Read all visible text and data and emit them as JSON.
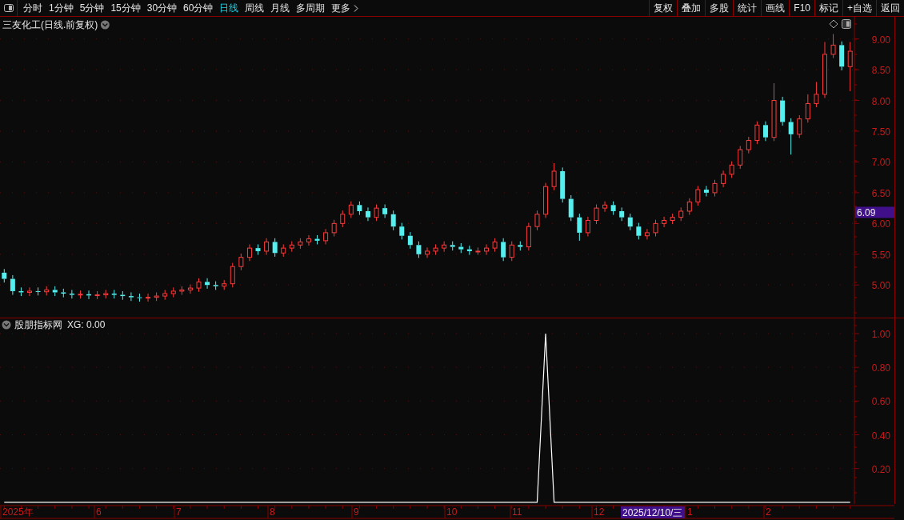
{
  "toolbar": {
    "periods": [
      {
        "label": "分时",
        "selected": false
      },
      {
        "label": "1分钟",
        "selected": false
      },
      {
        "label": "5分钟",
        "selected": false
      },
      {
        "label": "15分钟",
        "selected": false
      },
      {
        "label": "30分钟",
        "selected": false
      },
      {
        "label": "60分钟",
        "selected": false
      },
      {
        "label": "日线",
        "selected": true
      },
      {
        "label": "周线",
        "selected": false
      },
      {
        "label": "月线",
        "selected": false
      },
      {
        "label": "多周期",
        "selected": false
      },
      {
        "label": "更多",
        "selected": false
      }
    ],
    "actions": [
      "复权",
      "叠加",
      "多股",
      "统计",
      "画线",
      "F10",
      "标记",
      "+自选",
      "返回"
    ]
  },
  "main_chart": {
    "title": "三友化工(日线.前复权)",
    "price_cursor": "6.09",
    "chart_data": {
      "type": "candlestick",
      "grid": true,
      "ylim": [
        4.47,
        9.36
      ],
      "yticks": [
        {
          "value": 5,
          "label": "5.00"
        },
        {
          "value": 5.5,
          "label": "5.50"
        },
        {
          "value": 6,
          "label": "6.00"
        },
        {
          "value": 6.5,
          "label": "6.50"
        },
        {
          "value": 7,
          "label": "7.00"
        },
        {
          "value": 7.5,
          "label": "7.50"
        },
        {
          "value": 8,
          "label": "8.00"
        },
        {
          "value": 8.5,
          "label": "8.50"
        },
        {
          "value": 9,
          "label": "9.00"
        }
      ],
      "ohlc": [
        [
          5.2,
          5.26,
          5.04,
          5.1
        ],
        [
          5.1,
          5.16,
          4.84,
          4.9
        ],
        [
          4.9,
          4.96,
          4.82,
          4.88
        ],
        [
          4.88,
          4.96,
          4.82,
          4.9
        ],
        [
          4.9,
          4.96,
          4.83,
          4.89
        ],
        [
          4.89,
          4.98,
          4.83,
          4.92
        ],
        [
          4.92,
          4.98,
          4.82,
          4.88
        ],
        [
          4.88,
          4.94,
          4.8,
          4.86
        ],
        [
          4.86,
          4.92,
          4.78,
          4.84
        ],
        [
          4.84,
          4.91,
          4.78,
          4.85
        ],
        [
          4.85,
          4.91,
          4.77,
          4.83
        ],
        [
          4.83,
          4.9,
          4.77,
          4.84
        ],
        [
          4.84,
          4.92,
          4.78,
          4.86
        ],
        [
          4.86,
          4.92,
          4.78,
          4.84
        ],
        [
          4.84,
          4.9,
          4.76,
          4.82
        ],
        [
          4.82,
          4.88,
          4.74,
          4.8
        ],
        [
          4.8,
          4.86,
          4.73,
          4.79
        ],
        [
          4.79,
          4.86,
          4.73,
          4.8
        ],
        [
          4.8,
          4.88,
          4.74,
          4.82
        ],
        [
          4.82,
          4.92,
          4.76,
          4.86
        ],
        [
          4.86,
          4.96,
          4.8,
          4.9
        ],
        [
          4.9,
          4.98,
          4.84,
          4.92
        ],
        [
          4.92,
          5.01,
          4.86,
          4.95
        ],
        [
          4.95,
          5.11,
          4.89,
          5.05
        ],
        [
          5.05,
          5.11,
          4.94,
          5.0
        ],
        [
          5.0,
          5.06,
          4.92,
          4.98
        ],
        [
          4.98,
          5.08,
          4.92,
          5.02
        ],
        [
          5.02,
          5.36,
          4.96,
          5.3
        ],
        [
          5.3,
          5.51,
          5.24,
          5.45
        ],
        [
          5.45,
          5.66,
          5.39,
          5.6
        ],
        [
          5.6,
          5.66,
          5.49,
          5.55
        ],
        [
          5.55,
          5.76,
          5.49,
          5.7
        ],
        [
          5.7,
          5.76,
          5.46,
          5.52
        ],
        [
          5.52,
          5.66,
          5.46,
          5.6
        ],
        [
          5.6,
          5.71,
          5.54,
          5.65
        ],
        [
          5.65,
          5.76,
          5.59,
          5.7
        ],
        [
          5.7,
          5.81,
          5.64,
          5.75
        ],
        [
          5.75,
          5.81,
          5.66,
          5.72
        ],
        [
          5.72,
          5.91,
          5.66,
          5.85
        ],
        [
          5.85,
          6.06,
          5.79,
          6.0
        ],
        [
          6.0,
          6.21,
          5.94,
          6.15
        ],
        [
          6.15,
          6.36,
          6.09,
          6.3
        ],
        [
          6.3,
          6.36,
          6.14,
          6.2
        ],
        [
          6.2,
          6.26,
          6.04,
          6.1
        ],
        [
          6.1,
          6.31,
          6.04,
          6.25
        ],
        [
          6.25,
          6.31,
          6.09,
          6.15
        ],
        [
          6.15,
          6.21,
          5.89,
          5.95
        ],
        [
          5.95,
          6.01,
          5.74,
          5.8
        ],
        [
          5.8,
          5.86,
          5.59,
          5.65
        ],
        [
          5.65,
          5.71,
          5.44,
          5.5
        ],
        [
          5.5,
          5.61,
          5.44,
          5.55
        ],
        [
          5.55,
          5.66,
          5.49,
          5.6
        ],
        [
          5.6,
          5.71,
          5.54,
          5.65
        ],
        [
          5.65,
          5.71,
          5.56,
          5.62
        ],
        [
          5.62,
          5.68,
          5.52,
          5.58
        ],
        [
          5.58,
          5.64,
          5.49,
          5.55
        ],
        [
          5.55,
          5.61,
          5.49,
          5.55
        ],
        [
          5.55,
          5.66,
          5.49,
          5.6
        ],
        [
          5.6,
          5.76,
          5.54,
          5.7
        ],
        [
          5.7,
          5.76,
          5.39,
          5.45
        ],
        [
          5.45,
          5.71,
          5.39,
          5.65
        ],
        [
          5.65,
          5.71,
          5.56,
          5.62
        ],
        [
          5.62,
          6.01,
          5.56,
          5.95
        ],
        [
          5.95,
          6.21,
          5.89,
          6.15
        ],
        [
          6.15,
          6.66,
          6.09,
          6.6
        ],
        [
          6.6,
          6.98,
          6.54,
          6.85
        ],
        [
          6.85,
          6.91,
          6.34,
          6.4
        ],
        [
          6.4,
          6.46,
          6.04,
          6.1
        ],
        [
          6.1,
          6.16,
          5.72,
          5.85
        ],
        [
          5.85,
          6.11,
          5.79,
          6.05
        ],
        [
          6.05,
          6.31,
          5.99,
          6.25
        ],
        [
          6.25,
          6.36,
          6.19,
          6.3
        ],
        [
          6.3,
          6.36,
          6.14,
          6.2
        ],
        [
          6.2,
          6.26,
          6.04,
          6.1
        ],
        [
          6.1,
          6.16,
          5.89,
          5.95
        ],
        [
          5.95,
          6.01,
          5.74,
          5.8
        ],
        [
          5.8,
          5.91,
          5.74,
          5.85
        ],
        [
          5.85,
          6.06,
          5.79,
          6.0
        ],
        [
          6.0,
          6.11,
          5.94,
          6.05
        ],
        [
          6.05,
          6.16,
          5.99,
          6.1
        ],
        [
          6.1,
          6.26,
          6.04,
          6.2
        ],
        [
          6.2,
          6.41,
          6.14,
          6.35
        ],
        [
          6.35,
          6.61,
          6.29,
          6.55
        ],
        [
          6.55,
          6.61,
          6.44,
          6.5
        ],
        [
          6.5,
          6.71,
          6.44,
          6.65
        ],
        [
          6.65,
          6.86,
          6.59,
          6.8
        ],
        [
          6.8,
          7.01,
          6.74,
          6.95
        ],
        [
          6.95,
          7.26,
          6.89,
          7.2
        ],
        [
          7.2,
          7.41,
          7.14,
          7.35
        ],
        [
          7.35,
          7.66,
          7.29,
          7.6
        ],
        [
          7.6,
          7.66,
          7.34,
          7.4
        ],
        [
          7.4,
          8.28,
          7.34,
          8.0
        ],
        [
          8.0,
          8.06,
          7.59,
          7.65
        ],
        [
          7.65,
          7.71,
          7.12,
          7.45
        ],
        [
          7.45,
          7.76,
          7.39,
          7.7
        ],
        [
          7.7,
          8.1,
          7.64,
          7.95
        ],
        [
          7.95,
          8.3,
          7.89,
          8.1
        ],
        [
          8.1,
          8.95,
          8.04,
          8.75
        ],
        [
          8.75,
          9.08,
          8.69,
          8.9
        ],
        [
          8.9,
          8.96,
          8.49,
          8.55
        ],
        [
          8.55,
          8.95,
          8.15,
          8.8
        ]
      ]
    }
  },
  "indicator": {
    "title": "股朋指标网",
    "reading": "XG: 0.00",
    "chart_data": {
      "type": "line",
      "grid": true,
      "ylim": [
        -0.01,
        1
      ],
      "yticks": [
        {
          "value": 0.2,
          "label": "0.20"
        },
        {
          "value": 0.4,
          "label": "0.40"
        },
        {
          "value": 0.6,
          "label": "0.60"
        },
        {
          "value": 0.8,
          "label": "0.80"
        },
        {
          "value": 1,
          "label": "1.00"
        }
      ],
      "series": [
        {
          "values": [
            0,
            0,
            0,
            0,
            0,
            0,
            0,
            0,
            0,
            0,
            0,
            0,
            0,
            0,
            0,
            0,
            0,
            0,
            0,
            0,
            0,
            0,
            0,
            0,
            0,
            0,
            0,
            0,
            0,
            0,
            0,
            0,
            0,
            0,
            0,
            0,
            0,
            0,
            0,
            0,
            0,
            0,
            0,
            0,
            0,
            0,
            0,
            0,
            0,
            0,
            0,
            0,
            0,
            0,
            0,
            0,
            0,
            0,
            0,
            0,
            0,
            0,
            0,
            0,
            1,
            0,
            0,
            0,
            0,
            0,
            0,
            0,
            0,
            0,
            0,
            0,
            0,
            0,
            0,
            0,
            0,
            0,
            0,
            0,
            0,
            0,
            0,
            0,
            0,
            0,
            0,
            0,
            0,
            0,
            0,
            0,
            0,
            0,
            0,
            0,
            0
          ]
        }
      ]
    }
  },
  "time_axis": {
    "labels": [
      "2025年",
      "6",
      "7",
      "8",
      "9",
      "10",
      "11",
      "12",
      "1",
      "2"
    ],
    "cursor_date": "2025/12/10/三"
  }
}
